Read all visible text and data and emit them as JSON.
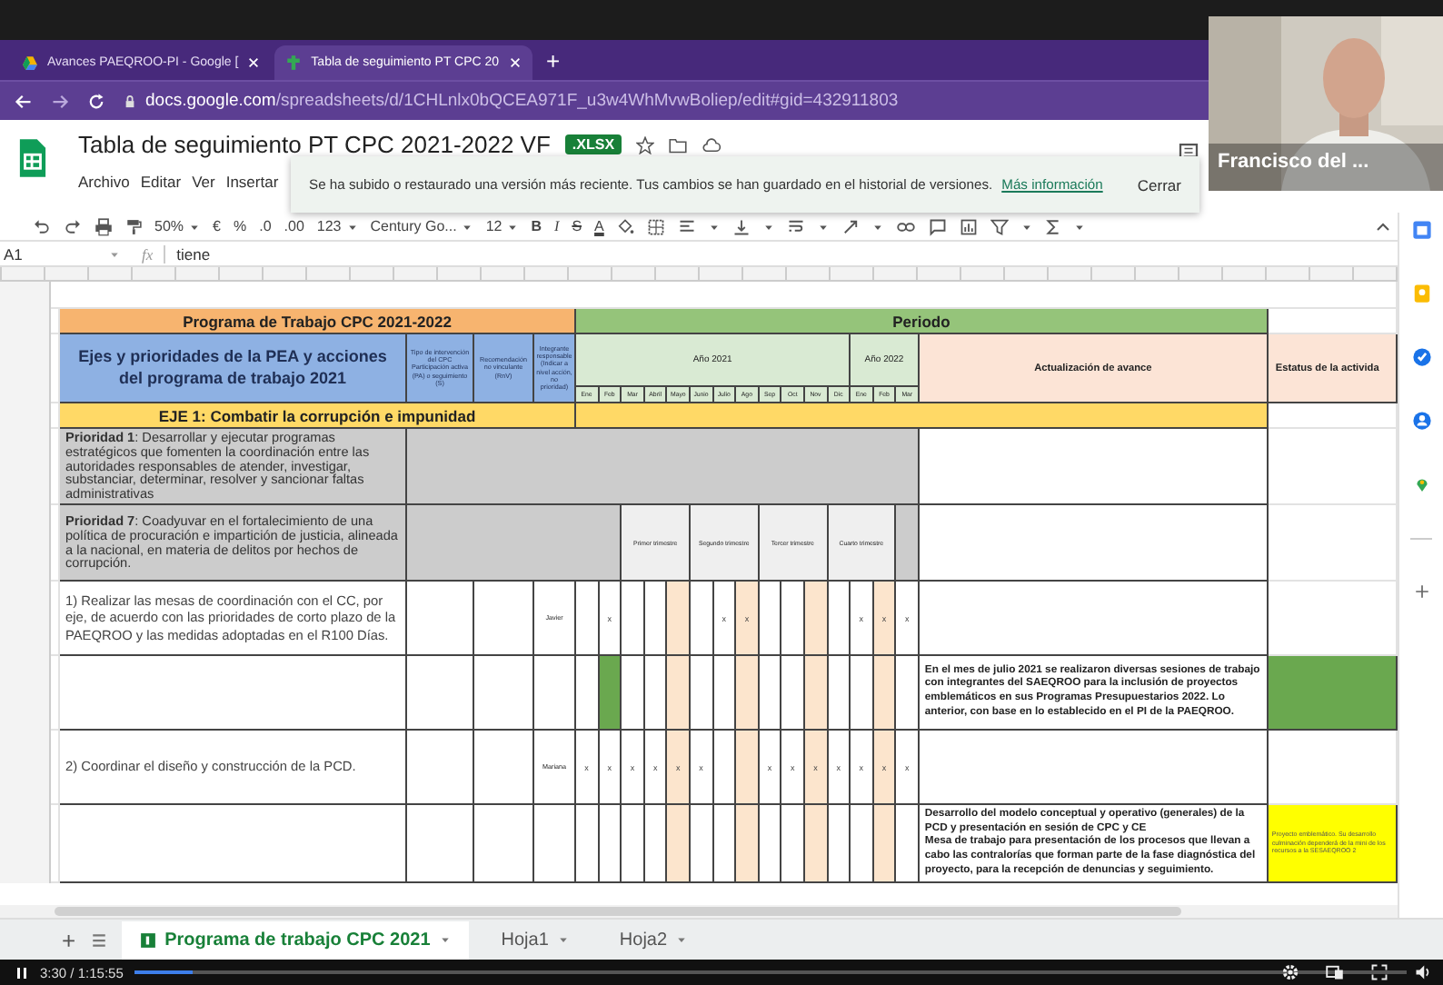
{
  "browser": {
    "tabs": [
      {
        "title": "Avances PAEQROO-PI - Google [",
        "selected": false
      },
      {
        "title": "Tabla de seguimiento PT CPC 20",
        "selected": true
      }
    ],
    "new_tab": "+",
    "url_host": "docs.google.com",
    "url_path": "/spreadsheets/d/1CHLnlx0bQCEA971F_u3w4WhMvwBoliep/edit#gid=432911803"
  },
  "doc": {
    "title": "Tabla de seguimiento PT CPC 2021-2022 VF",
    "badge": ".XLSX",
    "menus": [
      "Archivo",
      "Editar",
      "Ver",
      "Insertar"
    ]
  },
  "toast": {
    "message": "Se ha subido o restaurado una versión más reciente. Tus cambios se han guardado en el historial de versiones.",
    "link": "Más información",
    "action": "Cerrar"
  },
  "toolbar": {
    "zoom": "50%",
    "currency": "€",
    "percent": "%",
    "decrease_decimals": ".0",
    "increase_decimals": ".00",
    "number_format": "123",
    "font": "Century Go...",
    "font_size": "12",
    "format_buttons": [
      {
        "label": "B",
        "kind": "bold"
      },
      {
        "label": "I",
        "kind": "italic"
      },
      {
        "label": "S",
        "kind": "strike"
      },
      {
        "label": "A",
        "kind": "color"
      }
    ]
  },
  "formula_bar": {
    "cell": "A1",
    "fx": "fx",
    "value": "tiene"
  },
  "sheet": {
    "program_title": "Programa de Trabajo CPC 2021-2022",
    "period_title": "Periodo",
    "headers": {
      "actions": "Ejes y prioridades de la PEA y acciones del programa de trabajo 2021",
      "intervention": "Tipo de intervención del CPC Participación activa (PA) o seguimiento (S)",
      "recommendation": "Recomendación no vinculante (RnV)",
      "responsible": "Integrante responsable (Indicar a nivel acción, no prioridad)",
      "year_2021": "Año 2021",
      "year_2022": "Año 2022",
      "update": "Actualización de avance",
      "status": "Estatus de la activida"
    },
    "months": [
      {
        "label": "Ene",
        "highlighted": false
      },
      {
        "label": "Feb",
        "highlighted": false
      },
      {
        "label": "Mar",
        "highlighted": false
      },
      {
        "label": "Abril",
        "highlighted": false
      },
      {
        "label": "Mayo",
        "highlighted": true
      },
      {
        "label": "Junio",
        "highlighted": false
      },
      {
        "label": "Julio",
        "highlighted": false
      },
      {
        "label": "Ago",
        "highlighted": true
      },
      {
        "label": "Sep",
        "highlighted": false
      },
      {
        "label": "Oct",
        "highlighted": false
      },
      {
        "label": "Nov",
        "highlighted": true
      },
      {
        "label": "Dic",
        "highlighted": false
      },
      {
        "label": "Ene",
        "highlighted": false
      },
      {
        "label": "Feb",
        "highlighted": true
      },
      {
        "label": "Mar",
        "highlighted": false
      }
    ],
    "rows": [
      {
        "kind": "axis",
        "text": "EJE 1: Combatir la corrupción e impunidad"
      },
      {
        "kind": "priority",
        "text": "**Prioridad 1**: Desarrollar y ejecutar programas estratégicos que fomenten la coordinación entre las autoridades responsables de atender, investigar, substanciar, determinar, resolver y sancionar faltas administrativas"
      },
      {
        "kind": "priority",
        "text": "**Prioridad 7**: Coadyuvar en el fortalecimiento de una política de procuración e impartición de justicia, alineada a la nacional, en materia de delitos por hechos de corrupción.",
        "quarters": [
          "Primer trimestre",
          "Segundo trimestre",
          "Tercer trimestre",
          "Cuarto trimestre"
        ]
      },
      {
        "kind": "action",
        "text": "1) Realizar las mesas de coordinación con el CC, por eje, de acuerdo con las prioridades de corto plazo de la PAEQROO y las medidas adoptadas en el R100 Días.",
        "responsible": "Javier",
        "cells": [
          {
            "filled": false
          },
          {
            "filled": false,
            "mark": "x"
          },
          {
            "filled": false
          },
          {
            "filled": false
          },
          {
            "filled": false
          },
          {
            "filled": false
          },
          {
            "filled": false,
            "mark": "x"
          },
          {
            "filled": false,
            "mark": "x"
          },
          {
            "filled": false
          },
          {
            "filled": false
          },
          {
            "filled": false
          },
          {
            "filled": false
          },
          {
            "filled": false,
            "mark": "x"
          },
          {
            "filled": false,
            "mark": "x"
          },
          {
            "filled": false,
            "mark": "x"
          }
        ]
      },
      {
        "kind": "action",
        "cells": [
          {
            "filled": false
          },
          {
            "filled": true
          },
          {
            "filled": false
          },
          {
            "filled": false
          },
          {
            "filled": false
          },
          {
            "filled": false
          },
          {
            "filled": false
          },
          {
            "filled": false
          },
          {
            "filled": false
          },
          {
            "filled": false
          },
          {
            "filled": false
          },
          {
            "filled": false
          },
          {
            "filled": false
          },
          {
            "filled": false
          },
          {
            "filled": false
          }
        ],
        "update": "En el mes de julio 2021 se realizaron diversas sesiones de trabajo con integrantes del SAEQROO para la inclusión de proyectos emblemáticos en sus Programas Presupuestarios 2022. Lo anterior, con base en lo establecido en el PI de la PAEQROO.",
        "status": {
          "color": "#6aa84f"
        }
      },
      {
        "kind": "action",
        "text": "2) Coordinar el diseño y construcción de la PCD.",
        "responsible": "Mariana",
        "cells": [
          {
            "filled": false,
            "mark": "x"
          },
          {
            "filled": false,
            "mark": "x"
          },
          {
            "filled": false,
            "mark": "x"
          },
          {
            "filled": false,
            "mark": "x"
          },
          {
            "filled": false,
            "mark": "x"
          },
          {
            "filled": false,
            "mark": "x"
          },
          {
            "filled": false
          },
          {
            "filled": false
          },
          {
            "filled": false,
            "mark": "x"
          },
          {
            "filled": false,
            "mark": "x"
          },
          {
            "filled": false,
            "mark": "x"
          },
          {
            "filled": false,
            "mark": "x"
          },
          {
            "filled": false,
            "mark": "x"
          },
          {
            "filled": false,
            "mark": "x"
          },
          {
            "filled": false,
            "mark": "x"
          }
        ]
      },
      {
        "kind": "action",
        "cells": [
          {
            "filled": false
          },
          {
            "filled": false
          },
          {
            "filled": false
          },
          {
            "filled": false
          },
          {
            "filled": false
          },
          {
            "filled": false
          },
          {
            "filled": false
          },
          {
            "filled": false
          },
          {
            "filled": false
          },
          {
            "filled": false
          },
          {
            "filled": false
          },
          {
            "filled": false
          },
          {
            "filled": false
          },
          {
            "filled": false
          },
          {
            "filled": false
          }
        ],
        "update": "Desarrollo del modelo conceptual y operativo (generales) de la PCD y presentación en sesión de CPC y CE\nMesa de trabajo para presentación de los procesos que llevan a cabo las contralorías que forman parte de la fase diagnóstica del proyecto, para la recepción de denuncias y seguimiento.",
        "status": {
          "color": "#ffff00",
          "text": "Proyecto emblemático. Su desarrollo culminación dependerá de la mini de los recursos a la SESAEQROO 2"
        }
      }
    ]
  },
  "sheet_tabs": {
    "add": "+",
    "sheets": [
      {
        "name": "Programa de trabajo CPC 2021",
        "selected": true
      },
      {
        "name": "Hoja1",
        "selected": false
      },
      {
        "name": "Hoja2",
        "selected": false
      }
    ]
  },
  "video": {
    "participant": "Francisco del ...",
    "time": "3:30 / 1:15:55",
    "level": 0.046
  }
}
